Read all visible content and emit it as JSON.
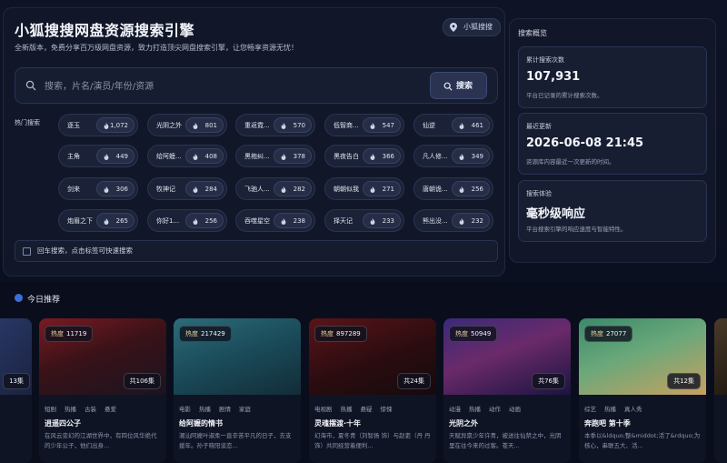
{
  "header": {
    "title": "小狐搜搜网盘资源搜索引擎",
    "subtitle": "全新版本，免费分享百万级网盘资源，致力打造顶尖网盘搜索引擎，让您畅享资源无忧！",
    "brand_label": "小狐搜搜"
  },
  "search": {
    "placeholder": "搜索，片名/演员/年份/资源",
    "button_label": "搜索"
  },
  "hot": {
    "label": "热门搜索",
    "tags": [
      {
        "name": "逐玉",
        "count": "1,072"
      },
      {
        "name": "光阴之外",
        "count": "801"
      },
      {
        "name": "重返霓...",
        "count": "570"
      },
      {
        "name": "低智商...",
        "count": "547"
      },
      {
        "name": "仙逆",
        "count": "461"
      },
      {
        "name": "主角",
        "count": "449"
      },
      {
        "name": "给阿嬷...",
        "count": "408"
      },
      {
        "name": "黑袍纠...",
        "count": "378"
      },
      {
        "name": "黑夜告白",
        "count": "366"
      },
      {
        "name": "凡人修...",
        "count": "349"
      },
      {
        "name": "剑来",
        "count": "306"
      },
      {
        "name": "牧神记",
        "count": "284"
      },
      {
        "name": "飞驰人...",
        "count": "282"
      },
      {
        "name": "朝朝似我",
        "count": "271"
      },
      {
        "name": "唐朝诡...",
        "count": "256"
      },
      {
        "name": "炮眉之下",
        "count": "265"
      },
      {
        "name": "你好1...",
        "count": "256"
      },
      {
        "name": "吞噬星空",
        "count": "238"
      },
      {
        "name": "择天记",
        "count": "233"
      },
      {
        "name": "熊出没...",
        "count": "232"
      }
    ],
    "hint": "回车搜索，点击标签可快速搜索"
  },
  "stats": {
    "heading": "搜索概览",
    "items": [
      {
        "label": "累计搜索次数",
        "value": "107,931",
        "desc": "平台已记录的累计搜索次数。"
      },
      {
        "label": "最近更新",
        "value": "2026-06-08 21:45",
        "desc": "资源库内容最近一次更新的时间。"
      },
      {
        "label": "搜索体验",
        "value": "毫秒级响应",
        "desc": "平台搜索引擎的响应速度与智能特性。"
      }
    ]
  },
  "recommend": {
    "title": "今日推荐",
    "heat_label": "热度",
    "edge_left_count": "13集",
    "cards": [
      {
        "heat": "11719",
        "eps": "共106集",
        "tags": [
          "短剧",
          "热播",
          "古装",
          "悬爱"
        ],
        "title": "逍遥四公子",
        "desc": "在风云变幻的江湖世界中，有四位风华绝代的少年公子，他们出身..."
      },
      {
        "heat": "217429",
        "eps": "",
        "tags": [
          "电影",
          "热播",
          "剧情",
          "家庭"
        ],
        "title": "给阿嬷的情书",
        "desc": "潮汕阿嬷叶淑柔一直辛苦平凡的日子，去支援年。孙子晓阳谈恋..."
      },
      {
        "heat": "897289",
        "eps": "共24集",
        "tags": [
          "电视剧",
          "热播",
          "悬疑",
          "惊悚"
        ],
        "title": "灵魂摆渡·十年",
        "desc": "幻海市，夏冬青（刘智扬 饰）与赵吏（丹 丹 饰）共同经营着便利..."
      },
      {
        "heat": "50949",
        "eps": "共76集",
        "tags": [
          "动漫",
          "热播",
          "动作",
          "动画"
        ],
        "title": "光阴之外",
        "desc": "天赋异禀少年许青，被送往仙禁之中，光阴里在往今来的过客。苍天..."
      },
      {
        "heat": "27077",
        "eps": "共12集",
        "tags": [
          "综艺",
          "热播",
          "真人秀"
        ],
        "title": "奔跑吧 第十季",
        "desc": "本季以&ldquo;整&middot;活了&rdquo;为核心，串联五大、活..."
      }
    ]
  },
  "colors": {
    "background": "#0a0e1c",
    "card": "#111728",
    "accent": "#3a6fd8"
  }
}
